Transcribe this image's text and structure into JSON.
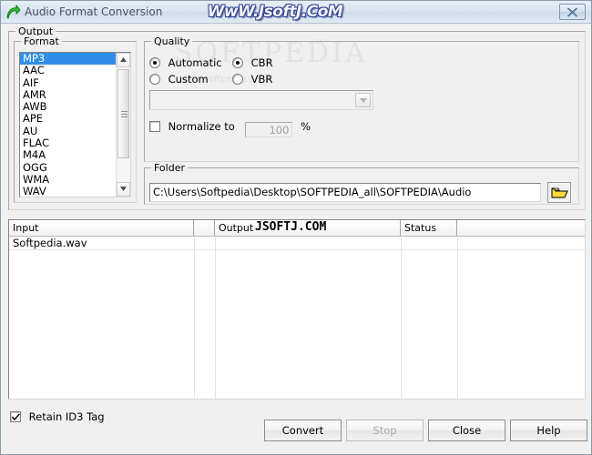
{
  "window": {
    "title": "Audio Format Conversion",
    "icon": "green-arrow-icon",
    "close_label": "✕",
    "watermark": "WwW.JsoftJ.CoM",
    "background_color": "#f0f0f0",
    "titlebar_color": "#dbe5ef"
  },
  "output_group": {
    "legend": "Output"
  },
  "format_group": {
    "legend": "Format",
    "selected": "MP3",
    "items": [
      "MP3",
      "AAC",
      "AIF",
      "AMR",
      "AWB",
      "APE",
      "AU",
      "FLAC",
      "M4A",
      "OGG",
      "WMA",
      "WAV"
    ],
    "selection_color": "#2f8fe8"
  },
  "quality_group": {
    "legend": "Quality",
    "mode_options": [
      {
        "label": "Automatic",
        "checked": true
      },
      {
        "label": "Custom",
        "checked": false
      }
    ],
    "rate_options": [
      {
        "label": "CBR",
        "checked": true
      },
      {
        "label": "VBR",
        "checked": false
      }
    ],
    "preset_combo": {
      "value": "",
      "enabled": false
    },
    "normalize": {
      "label": "Normalize to",
      "checked": false,
      "value": "100",
      "unit": "%",
      "enabled": false
    }
  },
  "folder_group": {
    "legend": "Folder",
    "path": "C:\\Users\\Softpedia\\Desktop\\SOFTPEDIA_all\\SOFTPEDIA\\Audio",
    "browse_icon": "folder-open-icon"
  },
  "file_list": {
    "columns": [
      "Input",
      "",
      "Output",
      "Status",
      ""
    ],
    "watermark": "JSOFTJ.COM",
    "rows": [
      {
        "input": "Softpedia.wav",
        "blank": "",
        "output": "",
        "status": "",
        "trailing": ""
      }
    ]
  },
  "page_watermarks": {
    "softpedia_large": "SOFTPEDIA",
    "softpedia_small": "www.softpedia.com",
    "trademark": "™"
  },
  "footer": {
    "retain_id3": {
      "label": "Retain ID3 Tag",
      "checked": true
    },
    "buttons": [
      {
        "label": "Convert",
        "enabled": true
      },
      {
        "label": "Stop",
        "enabled": false
      },
      {
        "label": "Close",
        "enabled": true
      },
      {
        "label": "Help",
        "enabled": true
      }
    ]
  }
}
